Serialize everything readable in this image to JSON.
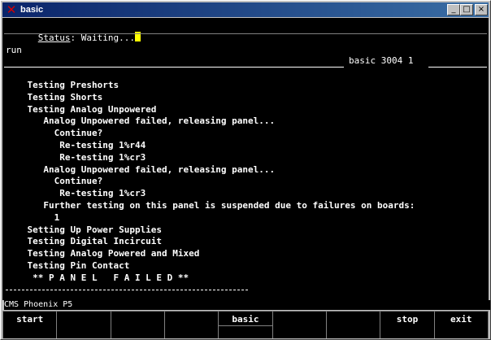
{
  "window": {
    "title": "basic"
  },
  "titlebar": {
    "minimize_label": "_",
    "maximize_label": "□",
    "close_label": "×"
  },
  "status": {
    "label": "Status",
    "text": ": Waiting..."
  },
  "session": {
    "command": "run",
    "banner": "basic 3004 1"
  },
  "log": [
    "    Testing Preshorts",
    "    Testing Shorts",
    "    Testing Analog Unpowered",
    "       Analog Unpowered failed, releasing panel...",
    "         Continue?",
    "          Re-testing 1%r44",
    "          Re-testing 1%cr3",
    "       Analog Unpowered failed, releasing panel...",
    "         Continue?",
    "          Re-testing 1%cr3",
    "       Further testing on this panel is suspended due to failures on boards:",
    "         1",
    "    Setting Up Power Supplies",
    "    Testing Digital Incircuit",
    "    Testing Analog Powered and Mixed",
    "    Testing Pin Contact",
    "     ** P A N E L   F A I L E D **"
  ],
  "footer": {
    "label": "CMS Phoenix P5"
  },
  "function_keys": [
    {
      "label": "start"
    },
    {
      "label": ""
    },
    {
      "label": ""
    },
    {
      "label": ""
    },
    {
      "label": "basic"
    },
    {
      "label": ""
    },
    {
      "label": ""
    },
    {
      "label": "stop"
    },
    {
      "label": "exit"
    }
  ],
  "colors": {
    "title_bar": "#0a246a",
    "terminal_bg": "#000000",
    "terminal_fg": "#ffffff",
    "cursor": "#ffff00"
  }
}
